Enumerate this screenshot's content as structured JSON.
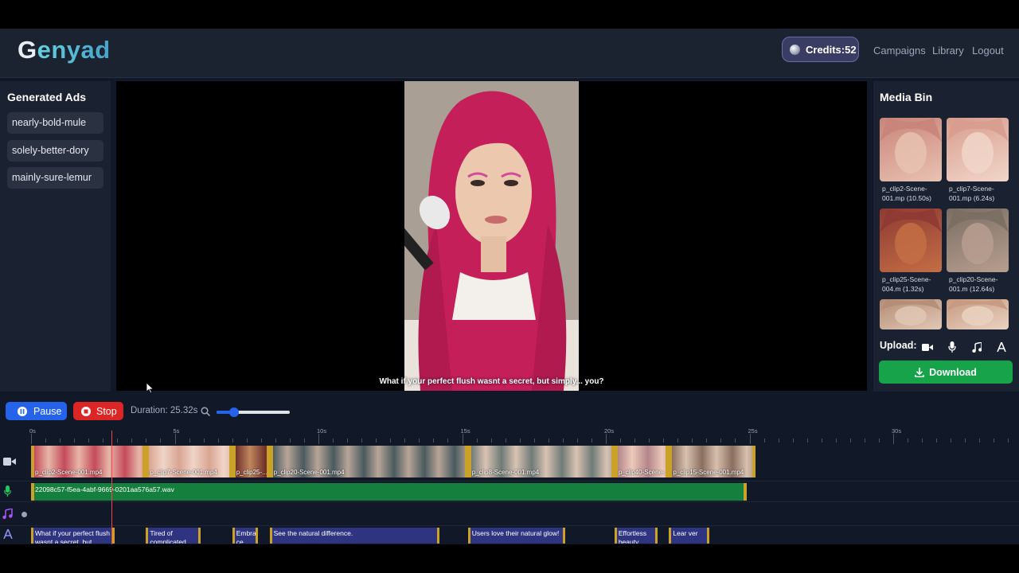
{
  "header": {
    "logo_g": "G",
    "logo_rest": "enyad",
    "credits": "Credits:52",
    "nav": [
      "Campaigns",
      "Library",
      "Logout"
    ]
  },
  "left_panel": {
    "title": "Generated Ads",
    "items": [
      "nearly-bold-mule",
      "solely-better-dory",
      "mainly-sure-lemur"
    ]
  },
  "preview": {
    "subtitle": "What if your perfect flush wasnt a secret, but simply... you?"
  },
  "media_bin": {
    "title": "Media Bin",
    "items": [
      {
        "label": "p_clip2-Scene-001.mp (10.50s)",
        "colors": [
          "#c98479",
          "#e8c2b2"
        ]
      },
      {
        "label": "p_clip7-Scene-001.mp (6.24s)",
        "colors": [
          "#d79c8d",
          "#f1d6c9"
        ]
      },
      {
        "label": "p_clip25-Scene-004.m (1.32s)",
        "colors": [
          "#8e3a33",
          "#c46e45"
        ]
      },
      {
        "label": "p_clip20-Scene-001.m (12.64s)",
        "colors": [
          "#7a6e63",
          "#b79e8f"
        ]
      },
      {
        "label": "",
        "colors": [
          "#b48d75",
          "#e1c7b5"
        ]
      },
      {
        "label": "",
        "colors": [
          "#c69a80",
          "#ead2c1"
        ]
      }
    ],
    "upload_label": "Upload:",
    "upload_buttons": [
      {
        "icon": "video-camera-icon",
        "color": "#0d9488"
      },
      {
        "icon": "microphone-icon",
        "color": "#0284c7"
      },
      {
        "icon": "music-note-icon",
        "color": "#9333ea"
      },
      {
        "icon": "text-a-icon",
        "color": "#4f46e5"
      }
    ],
    "download_label": "Download"
  },
  "controls": {
    "pause_label": "Pause",
    "stop_label": "Stop",
    "duration": "Duration: 25.32s",
    "zoom_level": 0.24
  },
  "timeline": {
    "ticks": [
      "0s",
      "5s",
      "10s",
      "15s",
      "20s",
      "25s",
      "30s"
    ],
    "playhead_seconds": 2.8,
    "video_clips": [
      {
        "label": "p_clip2-Scene-001.mp4",
        "start": 0,
        "end": 4.0
      },
      {
        "label": "p_clip7-Scene-001.mp4",
        "start": 4.0,
        "end": 7.0
      },
      {
        "label": "p_clip25-...",
        "start": 7.0,
        "end": 8.3
      },
      {
        "label": "p_clip20-Scene-001.mp4",
        "start": 8.3,
        "end": 15.2
      },
      {
        "label": "p_clip8-Scene-001.mp4",
        "start": 15.2,
        "end": 20.3
      },
      {
        "label": "p_clip40-Scene-...",
        "start": 20.3,
        "end": 22.2
      },
      {
        "label": "p_clip15-Scene-001.mp4",
        "start": 22.2,
        "end": 25.2
      }
    ],
    "audio_clip": {
      "label": "22098c57-f5ea-4abf-9669-0201aa576a57.wav",
      "start": 0,
      "end": 24.9
    },
    "text_clips": [
      {
        "label": "What if your perfect flush wasnt a secret, but",
        "start": 0,
        "end": 2.9
      },
      {
        "label": "Tired of complicated",
        "start": 4.0,
        "end": 5.9
      },
      {
        "label": "Embra ce",
        "start": 7.0,
        "end": 7.9
      },
      {
        "label": "See the natural difference.",
        "start": 8.3,
        "end": 14.2
      },
      {
        "label": "Users love their natural glow!",
        "start": 15.2,
        "end": 18.6
      },
      {
        "label": "Effortless beauty",
        "start": 20.3,
        "end": 21.8
      },
      {
        "label": "Lear ver",
        "start": 22.2,
        "end": 23.6
      }
    ]
  }
}
